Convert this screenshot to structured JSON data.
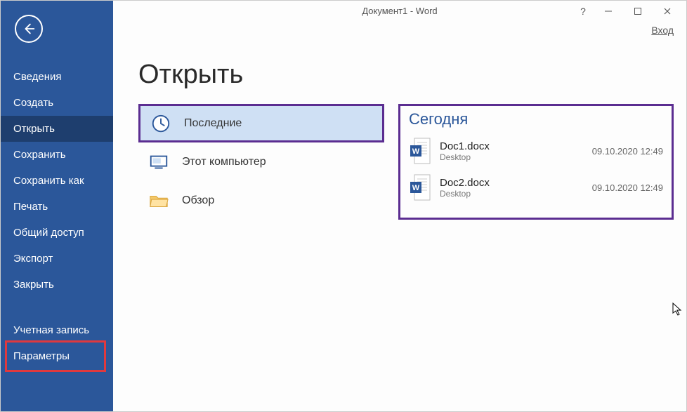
{
  "window": {
    "title": "Документ1 - Word",
    "signin": "Вход"
  },
  "sidebar": {
    "items": [
      {
        "label": "Сведения"
      },
      {
        "label": "Создать"
      },
      {
        "label": "Открыть",
        "selected": true
      },
      {
        "label": "Сохранить"
      },
      {
        "label": "Сохранить как"
      },
      {
        "label": "Печать"
      },
      {
        "label": "Общий доступ"
      },
      {
        "label": "Экспорт"
      },
      {
        "label": "Закрыть"
      }
    ],
    "footer": [
      {
        "label": "Учетная запись"
      },
      {
        "label": "Параметры",
        "highlighted": true
      }
    ]
  },
  "page": {
    "title": "Открыть"
  },
  "places": [
    {
      "label": "Последние",
      "icon": "clock",
      "selected": true
    },
    {
      "label": "Этот компьютер",
      "icon": "computer"
    },
    {
      "label": "Обзор",
      "icon": "folder"
    }
  ],
  "files": {
    "group": "Сегодня",
    "items": [
      {
        "name": "Doc1.docx",
        "location": "Desktop",
        "date": "09.10.2020 12:49"
      },
      {
        "name": "Doc2.docx",
        "location": "Desktop",
        "date": "09.10.2020 12:49"
      }
    ]
  }
}
